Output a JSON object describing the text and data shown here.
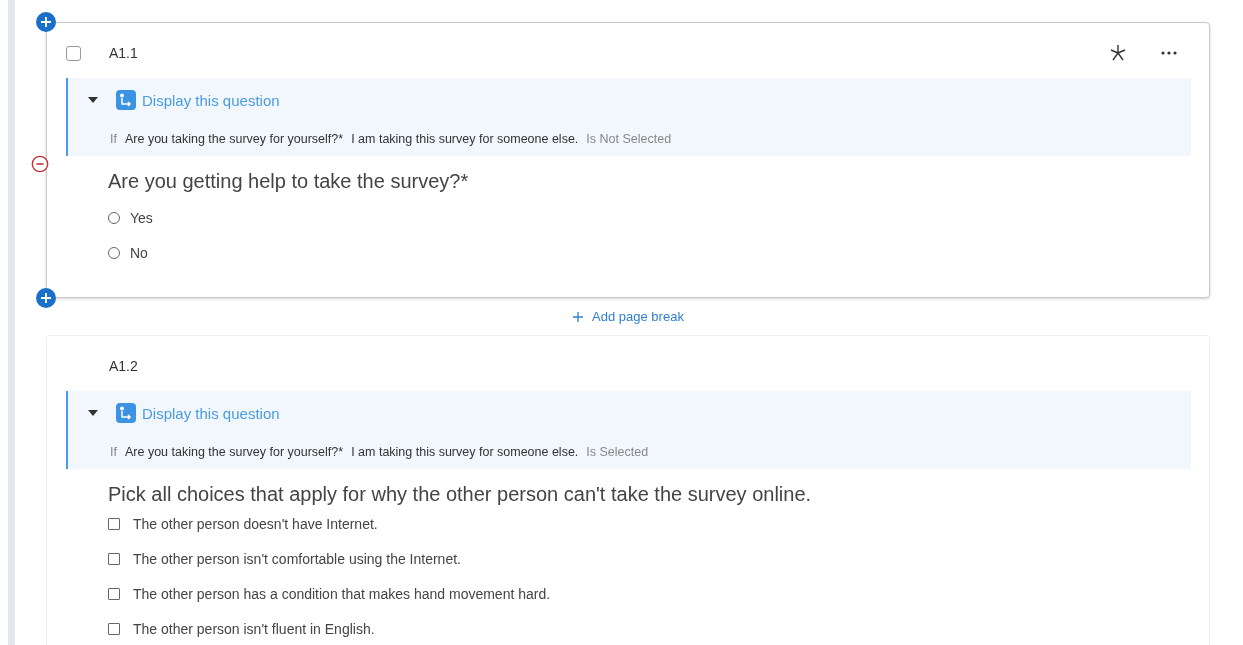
{
  "questions": [
    {
      "label": "A1.1",
      "active": true,
      "checked": false,
      "logic": {
        "title": "Display this question",
        "expanded": true,
        "prefix": "If",
        "question": "Are you taking the survey for yourself?*",
        "choice": "I am taking this survey for someone else.",
        "operator": "Is Not Selected"
      },
      "text": "Are you getting help to take the survey?*",
      "choices": [
        {
          "kind": "radio",
          "label": "Yes",
          "checked": false
        },
        {
          "kind": "radio",
          "label": "No",
          "checked": false
        }
      ]
    },
    {
      "label": "A1.2",
      "active": false,
      "logic": {
        "title": "Display this question",
        "expanded": true,
        "prefix": "If",
        "question": "Are you taking the survey for yourself?*",
        "choice": "I am taking this survey for someone else.",
        "operator": "Is Selected"
      },
      "text": "Pick all choices that apply for why the other person can't take the survey online.",
      "choices": [
        {
          "kind": "checkbox",
          "label": "The other person doesn't have Internet.",
          "checked": false
        },
        {
          "kind": "checkbox",
          "label": "The other person isn't comfortable using the Internet.",
          "checked": false
        },
        {
          "kind": "checkbox",
          "label": "The other person has a condition that makes hand movement hard.",
          "checked": false
        },
        {
          "kind": "checkbox",
          "label": "The other person isn't fluent in English.",
          "checked": false
        }
      ]
    }
  ],
  "page_break": "Add page break"
}
